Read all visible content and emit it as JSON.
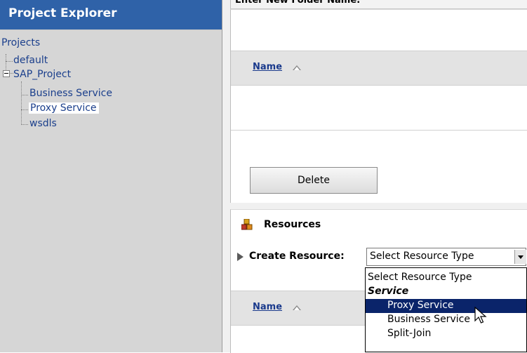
{
  "project_explorer": {
    "title": "Project Explorer",
    "tree": {
      "root": "Projects",
      "items": [
        {
          "label": "default"
        },
        {
          "label": "SAP_Project",
          "children": [
            "Business Service",
            "Proxy Service",
            "wsdls"
          ]
        }
      ],
      "selected": "Proxy Service"
    }
  },
  "folders": {
    "enter_folder_label": "Enter New Folder Name:",
    "name_column": "Name",
    "delete_button": "Delete"
  },
  "resources": {
    "title": "Resources",
    "create_label": "Create Resource:",
    "select_value": "Select Resource Type",
    "name_column": "Name",
    "dropdown_options": [
      "Select Resource Type",
      "Service",
      "Proxy Service",
      "Business Service",
      "Split-Join"
    ],
    "highlighted_option": "Proxy Service"
  },
  "colors": {
    "header_blue": "#2f62a8",
    "selection_navy": "#0a246a",
    "link_blue": "#1a3a8c"
  }
}
